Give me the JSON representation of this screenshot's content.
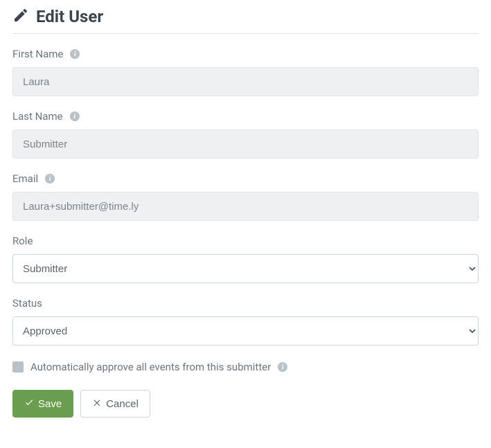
{
  "header": {
    "title": "Edit User"
  },
  "fields": {
    "first_name": {
      "label": "First Name",
      "value": "Laura"
    },
    "last_name": {
      "label": "Last Name",
      "value": "Submitter"
    },
    "email": {
      "label": "Email",
      "value": "Laura+submitter@time.ly"
    },
    "role": {
      "label": "Role",
      "value": "Submitter"
    },
    "status": {
      "label": "Status",
      "value": "Approved"
    }
  },
  "checkbox": {
    "auto_approve_label": "Automatically approve all events from this submitter"
  },
  "buttons": {
    "save": "Save",
    "cancel": "Cancel"
  }
}
